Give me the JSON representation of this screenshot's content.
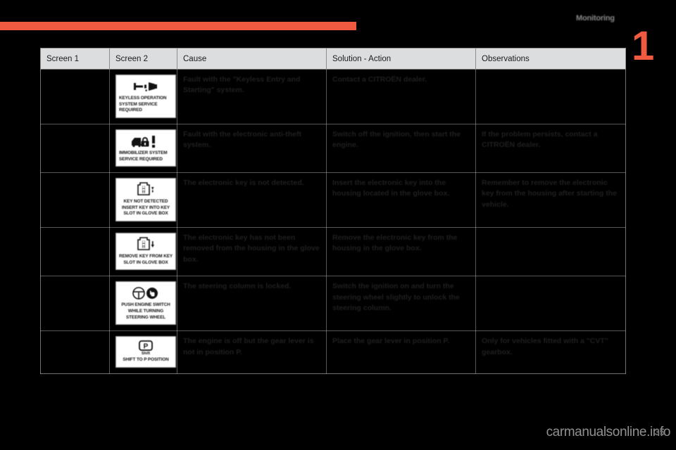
{
  "page": {
    "section_title": "Monitoring",
    "chapter_number": "1",
    "page_number": "35",
    "watermark": "carmanualsonline.info",
    "accent_color": "#f05a41",
    "header_bg_color": "#dcdddf"
  },
  "table": {
    "headers": {
      "screen1": "Screen 1",
      "screen2": "Screen 2",
      "cause": "Cause",
      "solution": "Solution - Action",
      "observations": "Observations"
    },
    "rows": [
      {
        "screen1": "",
        "screen2": {
          "icon": "key-horizontal-icon",
          "lines": [
            "KEYLESS OPERATION",
            "SYSTEM SERVICE",
            "REQUIRED"
          ],
          "align": "left"
        },
        "cause": "Fault with the \"Keyless Entry and Starting\" system.",
        "solution": "Contact a CITROËN dealer.",
        "observations": ""
      },
      {
        "screen1": "",
        "screen2": {
          "icon": "car-lock-warning-icon",
          "lines": [
            "IMMOBILIZER SYSTEM",
            "SERVICE REQUIRED"
          ],
          "align": "left"
        },
        "cause": "Fault with the electronic anti-theft system.",
        "solution": "Switch off the ignition, then start the engine.",
        "observations": "If the problem persists, contact a CITROËN dealer."
      },
      {
        "screen1": "",
        "screen2": {
          "icon": "key-slot-insert-icon",
          "lines": [
            "KEY NOT DETECTED",
            "INSERT KEY INTO KEY",
            "SLOT IN GLOVE BOX"
          ],
          "align": "center"
        },
        "cause": "The electronic key is not detected.",
        "solution": "Insert the electronic key into the housing located in the glove box.",
        "observations": "Remember to remove the electronic key from the housing after starting the vehicle."
      },
      {
        "screen1": "",
        "screen2": {
          "icon": "key-slot-remove-icon",
          "lines": [
            "REMOVE KEY FROM KEY",
            "SLOT IN GLOVE BOX"
          ],
          "align": "center"
        },
        "cause": "The electronic key has not been removed from the housing in the glove box.",
        "solution": "Remove the electronic key from the housing in the glove box.",
        "observations": ""
      },
      {
        "screen1": "",
        "screen2": {
          "icon": "engine-switch-steering-icon",
          "lines": [
            "PUSH ENGINE SWITCH",
            "WHILE TURNING",
            "STEERING WHEEL"
          ],
          "align": "center"
        },
        "cause": "The steering column is locked.",
        "solution": "Switch the ignition on and turn the steering wheel slightly to unlock the steering column.",
        "observations": ""
      },
      {
        "screen1": "",
        "screen2": {
          "icon": "shift-p-position-icon",
          "lines": [
            "SHIFT TO P POSITION"
          ],
          "align": "center"
        },
        "cause": "The engine is off but the gear lever is not in position P.",
        "solution": "Place the gear lever in position P.",
        "observations": "Only for vehicles fitted with a \"CVT\" gearbox."
      }
    ]
  }
}
